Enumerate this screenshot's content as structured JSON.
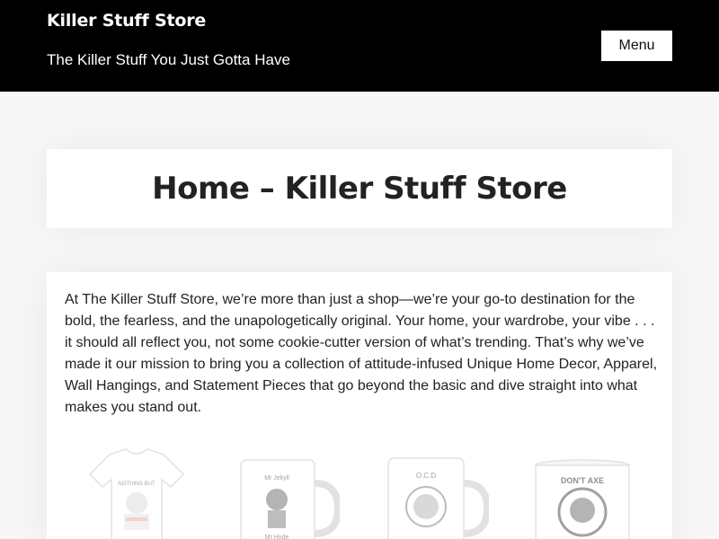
{
  "header": {
    "site_title": "Killer Stuff Store",
    "tagline": "The Killer Stuff You Just Gotta Have",
    "menu_label": "Menu"
  },
  "page": {
    "title": "Home – Killer Stuff Store",
    "intro": "At The Killer Stuff Store, we’re more than just a shop—we’re your go-to destination for the bold, the fearless, and the unapologetically original. Your home, your wardrobe, your vibe . . . it should all reflect you, not some cookie-cutter version of what’s trending. That’s why we’ve made it our mission to bring you a collection of attitude-infused Unique Home Decor, Apparel, Wall Hangings, and Statement Pieces that go beyond the basic and dive straight into what makes you stand out."
  },
  "products": [
    {
      "name": "t-shirt",
      "icon": "tshirt-image"
    },
    {
      "name": "mug",
      "icon": "mug-image"
    },
    {
      "name": "mug",
      "icon": "mug-image"
    },
    {
      "name": "enamel-mug",
      "icon": "enamel-mug-image"
    }
  ],
  "colors": {
    "header_bg": "#000000",
    "page_bg": "#f7f7f7",
    "card_bg": "#ffffff",
    "text": "#222222"
  }
}
